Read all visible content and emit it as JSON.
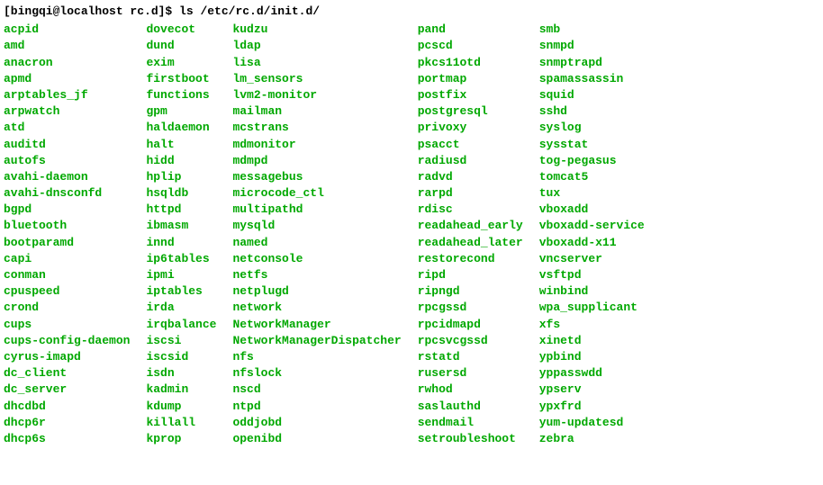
{
  "prompt": {
    "userhost": "[bingqi@localhost rc.d]$ ",
    "command": "ls /etc/rc.d/init.d/"
  },
  "columns": [
    [
      "acpid",
      "amd",
      "anacron",
      "apmd",
      "arptables_jf",
      "arpwatch",
      "atd",
      "auditd",
      "autofs",
      "avahi-daemon",
      "avahi-dnsconfd",
      "bgpd",
      "bluetooth",
      "bootparamd",
      "capi",
      "conman",
      "cpuspeed",
      "crond",
      "cups",
      "cups-config-daemon",
      "cyrus-imapd",
      "dc_client",
      "dc_server",
      "dhcdbd",
      "dhcp6r",
      "dhcp6s"
    ],
    [
      "dovecot",
      "dund",
      "exim",
      "firstboot",
      "functions",
      "gpm",
      "haldaemon",
      "halt",
      "hidd",
      "hplip",
      "hsqldb",
      "httpd",
      "ibmasm",
      "innd",
      "ip6tables",
      "ipmi",
      "iptables",
      "irda",
      "irqbalance",
      "iscsi",
      "iscsid",
      "isdn",
      "kadmin",
      "kdump",
      "killall",
      "kprop"
    ],
    [
      "kudzu",
      "ldap",
      "lisa",
      "lm_sensors",
      "lvm2-monitor",
      "mailman",
      "mcstrans",
      "mdmonitor",
      "mdmpd",
      "messagebus",
      "microcode_ctl",
      "multipathd",
      "mysqld",
      "named",
      "netconsole",
      "netfs",
      "netplugd",
      "network",
      "NetworkManager",
      "NetworkManagerDispatcher",
      "nfs",
      "nfslock",
      "nscd",
      "ntpd",
      "oddjobd",
      "openibd"
    ],
    [
      "pand",
      "pcscd",
      "pkcs11otd",
      "portmap",
      "postfix",
      "postgresql",
      "privoxy",
      "psacct",
      "radiusd",
      "radvd",
      "rarpd",
      "rdisc",
      "readahead_early",
      "readahead_later",
      "restorecond",
      "ripd",
      "ripngd",
      "rpcgssd",
      "rpcidmapd",
      "rpcsvcgssd",
      "rstatd",
      "rusersd",
      "rwhod",
      "saslauthd",
      "sendmail",
      "setroubleshoot"
    ],
    [
      "smb",
      "snmpd",
      "snmptrapd",
      "spamassassin",
      "squid",
      "sshd",
      "syslog",
      "sysstat",
      "tog-pegasus",
      "tomcat5",
      "tux",
      "vboxadd",
      "vboxadd-service",
      "vboxadd-x11",
      "vncserver",
      "vsftpd",
      "winbind",
      "wpa_supplicant",
      "xfs",
      "xinetd",
      "ypbind",
      "yppasswdd",
      "ypserv",
      "ypxfrd",
      "yum-updatesd",
      "zebra"
    ]
  ]
}
